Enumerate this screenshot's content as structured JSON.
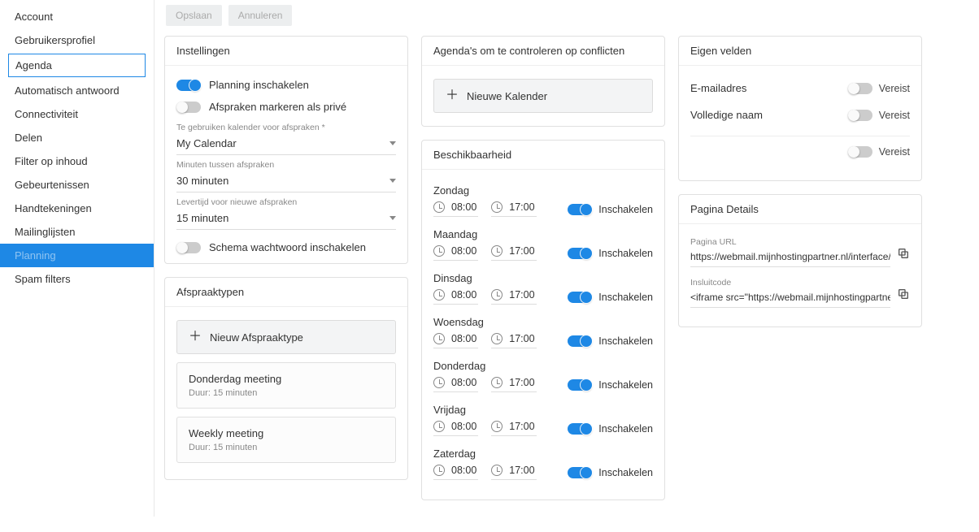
{
  "sidebar": {
    "items": [
      {
        "label": "Account"
      },
      {
        "label": "Gebruikersprofiel"
      },
      {
        "label": "Agenda"
      },
      {
        "label": "Automatisch antwoord"
      },
      {
        "label": "Connectiviteit"
      },
      {
        "label": "Delen"
      },
      {
        "label": "Filter op inhoud"
      },
      {
        "label": "Gebeurtenissen"
      },
      {
        "label": "Handtekeningen"
      },
      {
        "label": "Mailinglijsten"
      },
      {
        "label": "Planning"
      },
      {
        "label": "Spam filters"
      }
    ]
  },
  "topbar": {
    "save": "Opslaan",
    "cancel": "Annuleren"
  },
  "panels": {
    "settings": {
      "title": "Instellingen",
      "enable_scheduling": "Planning inschakelen",
      "mark_private": "Afspraken markeren als privé",
      "calendar_label": "Te gebruiken kalender voor afspraken *",
      "calendar_value": "My Calendar",
      "minutes_label": "Minuten tussen afspraken",
      "minutes_value": "30 minuten",
      "lead_label": "Levertijd voor nieuwe afspraken",
      "lead_value": "15 minuten",
      "password": "Schema wachtwoord inschakelen"
    },
    "types": {
      "title": "Afspraaktypen",
      "new": "Nieuw Afspraaktype",
      "items": [
        {
          "name": "Donderdag meeting",
          "duration": "Duur: 15 minuten"
        },
        {
          "name": "Weekly meeting",
          "duration": "Duur: 15 minuten"
        }
      ]
    },
    "conflicts": {
      "title": "Agenda's om te controleren op conflicten",
      "new": "Nieuwe Kalender"
    },
    "availability": {
      "title": "Beschikbaarheid",
      "enable": "Inschakelen",
      "days": [
        {
          "name": "Zondag",
          "start": "08:00",
          "end": "17:00"
        },
        {
          "name": "Maandag",
          "start": "08:00",
          "end": "17:00"
        },
        {
          "name": "Dinsdag",
          "start": "08:00",
          "end": "17:00"
        },
        {
          "name": "Woensdag",
          "start": "08:00",
          "end": "17:00"
        },
        {
          "name": "Donderdag",
          "start": "08:00",
          "end": "17:00"
        },
        {
          "name": "Vrijdag",
          "start": "08:00",
          "end": "17:00"
        },
        {
          "name": "Zaterdag",
          "start": "08:00",
          "end": "17:00"
        }
      ]
    },
    "custom": {
      "title": "Eigen velden",
      "fields": [
        {
          "label": "E-mailadres",
          "req": "Vereist"
        },
        {
          "label": "Volledige naam",
          "req": "Vereist"
        },
        {
          "label": "",
          "req": "Vereist"
        }
      ]
    },
    "details": {
      "title": "Pagina Details",
      "url_label": "Pagina URL",
      "url_value": "https://webmail.mijnhostingpartner.nl/interface/schedu",
      "embed_label": "Insluitcode",
      "embed_value": "<iframe src=\"https://webmail.mijnhostingpartner.nl/int"
    }
  }
}
